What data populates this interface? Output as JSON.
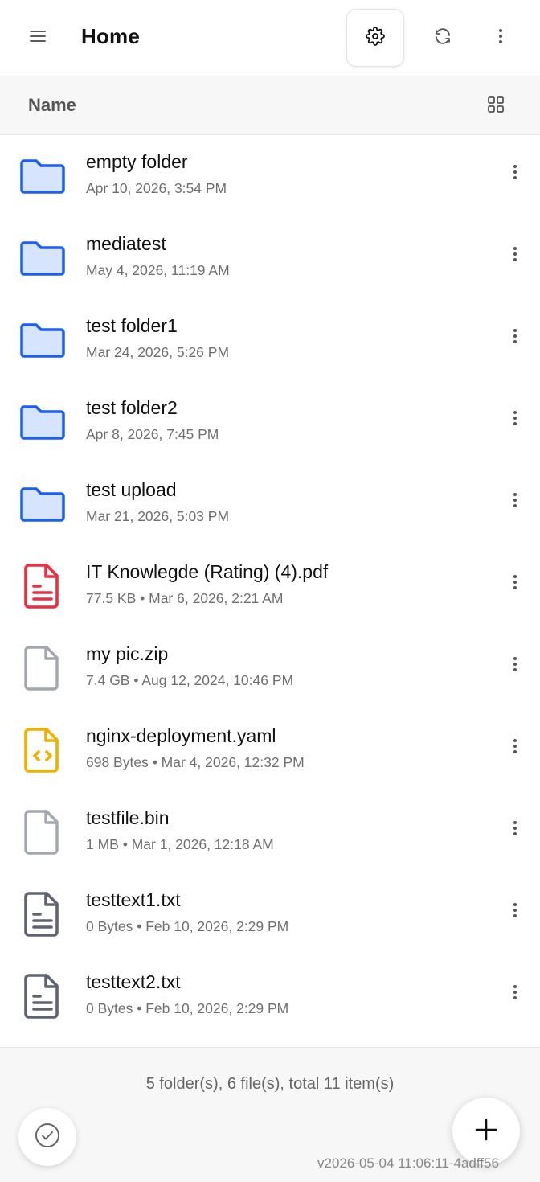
{
  "header": {
    "title": "Home",
    "menu_icon": "hamburger-menu-icon",
    "settings_icon": "gear-icon",
    "refresh_icon": "refresh-icon",
    "more_icon": "vertical-dots-icon"
  },
  "sortbar": {
    "label": "Name",
    "view_icon": "grid-view-icon"
  },
  "items": [
    {
      "name": "empty folder",
      "meta": "Apr 10, 2026, 3:54 PM",
      "icon": "folder-icon",
      "kind": "folder"
    },
    {
      "name": "mediatest",
      "meta": "May 4, 2026, 11:19 AM",
      "icon": "folder-icon",
      "kind": "folder"
    },
    {
      "name": "test folder1",
      "meta": "Mar 24, 2026, 5:26 PM",
      "icon": "folder-icon",
      "kind": "folder"
    },
    {
      "name": "test folder2",
      "meta": "Apr 8, 2026, 7:45 PM",
      "icon": "folder-icon",
      "kind": "folder"
    },
    {
      "name": "test upload",
      "meta": "Mar 21, 2026, 5:03 PM",
      "icon": "folder-icon",
      "kind": "folder"
    },
    {
      "name": "IT Knowlegde (Rating) (4).pdf",
      "meta": "77.5 KB • Mar 6, 2026, 2:21 AM",
      "icon": "pdf-file-icon",
      "kind": "pdf"
    },
    {
      "name": "my pic.zip",
      "meta": "7.4 GB • Aug 12, 2024, 10:46 PM",
      "icon": "generic-file-icon",
      "kind": "generic"
    },
    {
      "name": "nginx-deployment.yaml",
      "meta": "698 Bytes • Mar 4, 2026, 12:32 PM",
      "icon": "code-file-icon",
      "kind": "code"
    },
    {
      "name": "testfile.bin",
      "meta": "1 MB • Mar 1, 2026, 12:18 AM",
      "icon": "generic-file-icon",
      "kind": "generic"
    },
    {
      "name": "testtext1.txt",
      "meta": "0 Bytes • Feb 10, 2026, 2:29 PM",
      "icon": "text-file-icon",
      "kind": "text"
    },
    {
      "name": "testtext2.txt",
      "meta": "0 Bytes • Feb 10, 2026, 2:29 PM",
      "icon": "text-file-icon",
      "kind": "text"
    }
  ],
  "footer": {
    "summary": "5 folder(s), 6 file(s), total 11 item(s)",
    "version": "v2026-05-04 11:06:11-4adff56",
    "select_icon": "check-circle-icon",
    "add_icon": "plus-icon"
  },
  "colors": {
    "folder_stroke": "#1d5ef0",
    "folder_fill": "#d6e4fd",
    "pdf": "#ee2d3e",
    "code": "#f0b000",
    "generic": "#a3a8b0",
    "text": "#5f6470"
  }
}
